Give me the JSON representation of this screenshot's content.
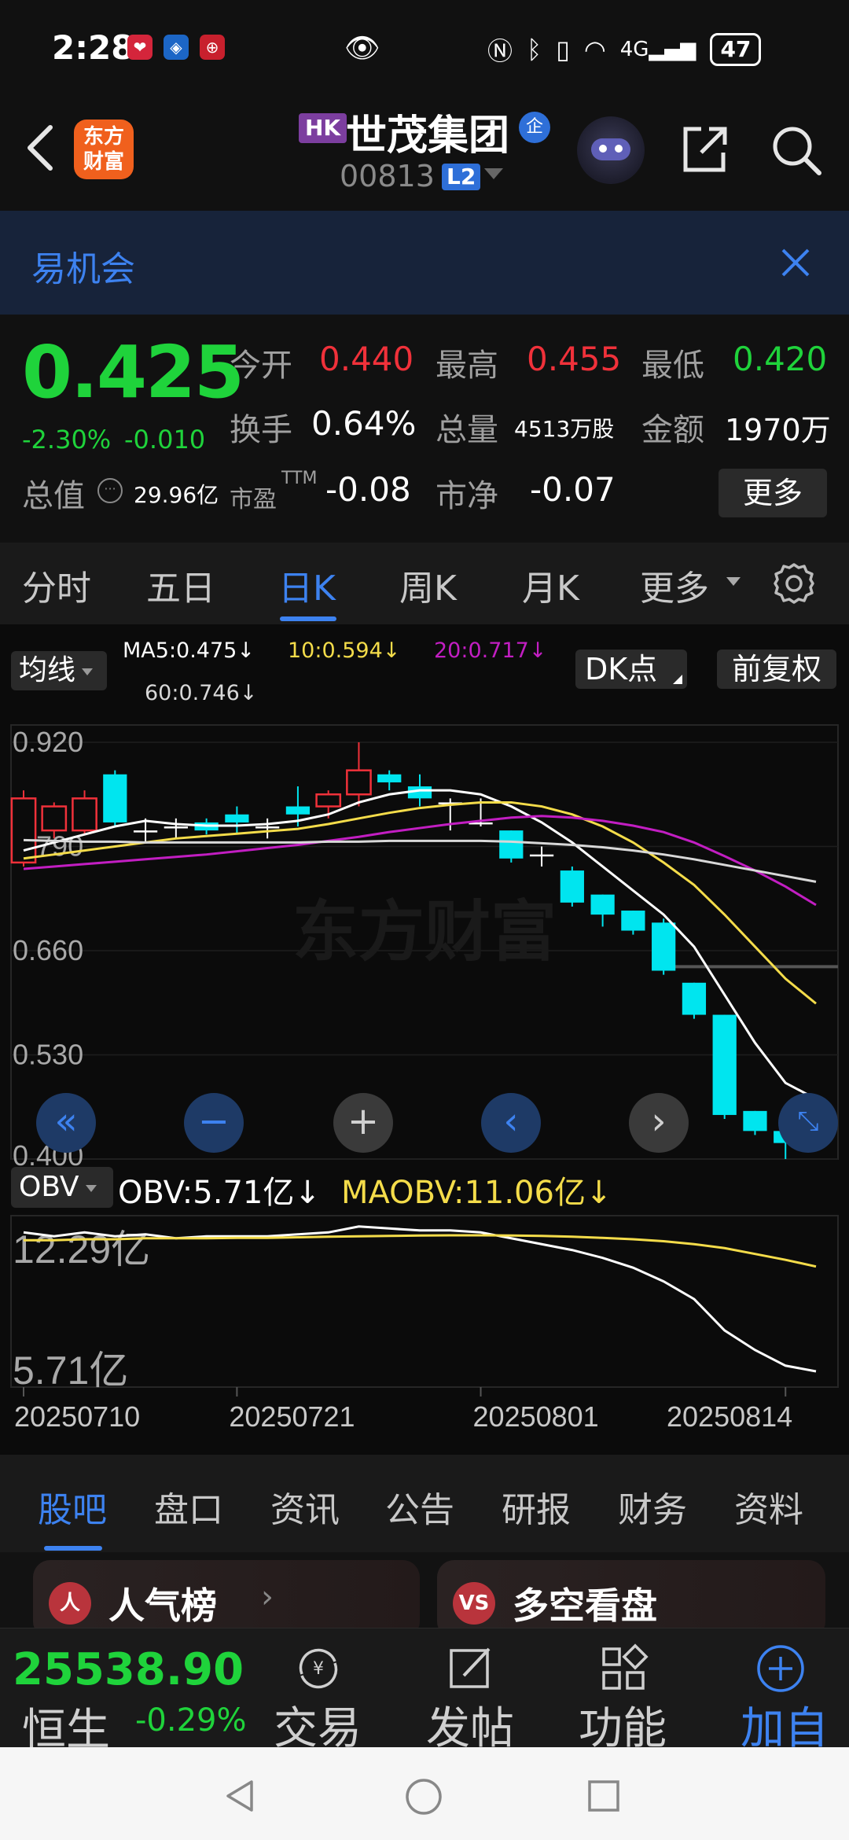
{
  "status_bar": {
    "time": "2:28",
    "battery": "47"
  },
  "header": {
    "logo_line1": "东方",
    "logo_line2": "财富",
    "market_badge": "HK",
    "stock_name": "世茂集团",
    "qi_badge": "企",
    "stock_code": "00813",
    "level_badge": "L2"
  },
  "banner": {
    "text": "易机会"
  },
  "quote": {
    "price": "0.425",
    "change_pct": "-2.30%",
    "change": "-0.010",
    "open_label": "今开",
    "open_value": "0.440",
    "high_label": "最高",
    "high_value": "0.455",
    "low_label": "最低",
    "low_value": "0.420",
    "turnover_label": "换手",
    "turnover_value": "0.64%",
    "volume_label": "总量",
    "volume_value": "4513万股",
    "amount_label": "金额",
    "amount_value": "1970万",
    "mktcap_label": "总值",
    "mktcap_value": "29.96亿",
    "pe_label": "市盈",
    "pe_sup": "TTM",
    "pe_value": "-0.08",
    "pb_label": "市净",
    "pb_value": "-0.07",
    "more_label": "更多"
  },
  "period_tabs": [
    "分时",
    "五日",
    "日K",
    "周K",
    "月K",
    "更多"
  ],
  "active_period": "日K",
  "indicators": {
    "ma_select": "均线",
    "ma5": "MA5:0.475↓",
    "ma10": "10:0.594↓",
    "ma20": "20:0.717↓",
    "ma60": "60:0.746↓",
    "dk_label": "DK点",
    "fq_label": "前复权",
    "obv_select": "OBV",
    "obv_value": "OBV:5.71亿↓",
    "maobv_value": "MAOBV:11.06亿↓"
  },
  "colors": {
    "up": "#f0313a",
    "down": "#1fd33b",
    "bar_down": "#00e5ef",
    "ma5": "#ffffff",
    "ma10": "#f4dc4a",
    "ma20": "#c21ec2",
    "ma60": "#d8d8d8",
    "accent": "#3d82f0"
  },
  "chart_data": {
    "type": "candlestick",
    "price_ticks": [
      "0.920",
      "0.790",
      "0.660",
      "0.530",
      "0.400"
    ],
    "ylim": [
      0.4,
      0.92
    ],
    "x_ticks": [
      "20250710",
      "20250721",
      "20250801",
      "20250814"
    ],
    "candles": [
      {
        "o": 0.77,
        "c": 0.85,
        "h": 0.86,
        "l": 0.765
      },
      {
        "o": 0.81,
        "c": 0.84,
        "h": 0.845,
        "l": 0.8
      },
      {
        "o": 0.81,
        "c": 0.85,
        "h": 0.86,
        "l": 0.805
      },
      {
        "o": 0.88,
        "c": 0.82,
        "h": 0.885,
        "l": 0.815
      },
      {
        "o": 0.81,
        "c": 0.81,
        "h": 0.825,
        "l": 0.795
      },
      {
        "o": 0.815,
        "c": 0.815,
        "h": 0.825,
        "l": 0.8
      },
      {
        "o": 0.82,
        "c": 0.81,
        "h": 0.825,
        "l": 0.805
      },
      {
        "o": 0.83,
        "c": 0.82,
        "h": 0.84,
        "l": 0.805
      },
      {
        "o": 0.815,
        "c": 0.815,
        "h": 0.825,
        "l": 0.8
      },
      {
        "o": 0.84,
        "c": 0.83,
        "h": 0.865,
        "l": 0.815
      },
      {
        "o": 0.84,
        "c": 0.855,
        "h": 0.86,
        "l": 0.825
      },
      {
        "o": 0.855,
        "c": 0.885,
        "h": 0.92,
        "l": 0.84
      },
      {
        "o": 0.88,
        "c": 0.87,
        "h": 0.885,
        "l": 0.86
      },
      {
        "o": 0.865,
        "c": 0.85,
        "h": 0.88,
        "l": 0.84
      },
      {
        "o": 0.845,
        "c": 0.845,
        "h": 0.85,
        "l": 0.81
      },
      {
        "o": 0.82,
        "c": 0.82,
        "h": 0.85,
        "l": 0.815
      },
      {
        "o": 0.81,
        "c": 0.775,
        "h": 0.81,
        "l": 0.77
      },
      {
        "o": 0.78,
        "c": 0.78,
        "h": 0.79,
        "l": 0.765
      },
      {
        "o": 0.76,
        "c": 0.72,
        "h": 0.765,
        "l": 0.715
      },
      {
        "o": 0.73,
        "c": 0.705,
        "h": 0.73,
        "l": 0.69
      },
      {
        "o": 0.71,
        "c": 0.685,
        "h": 0.71,
        "l": 0.68
      },
      {
        "o": 0.695,
        "c": 0.635,
        "h": 0.7,
        "l": 0.63
      },
      {
        "o": 0.62,
        "c": 0.58,
        "h": 0.62,
        "l": 0.575
      },
      {
        "o": 0.58,
        "c": 0.455,
        "h": 0.58,
        "l": 0.45
      },
      {
        "o": 0.46,
        "c": 0.435,
        "h": 0.46,
        "l": 0.43
      },
      {
        "o": 0.435,
        "c": 0.42,
        "h": 0.44,
        "l": 0.4
      },
      {
        "o": 0.44,
        "c": 0.425,
        "h": 0.455,
        "l": 0.42
      }
    ],
    "series": [
      {
        "name": "MA5",
        "values": [
          0.785,
          0.795,
          0.805,
          0.815,
          0.822,
          0.818,
          0.816,
          0.816,
          0.818,
          0.822,
          0.83,
          0.845,
          0.855,
          0.86,
          0.86,
          0.855,
          0.84,
          0.82,
          0.795,
          0.765,
          0.735,
          0.705,
          0.665,
          0.605,
          0.545,
          0.495,
          0.475
        ]
      },
      {
        "name": "10",
        "values": [
          0.775,
          0.78,
          0.785,
          0.79,
          0.795,
          0.8,
          0.803,
          0.806,
          0.809,
          0.812,
          0.818,
          0.825,
          0.832,
          0.838,
          0.842,
          0.845,
          0.845,
          0.84,
          0.83,
          0.815,
          0.795,
          0.77,
          0.742,
          0.705,
          0.665,
          0.625,
          0.594
        ]
      },
      {
        "name": "20",
        "values": [
          0.762,
          0.765,
          0.768,
          0.771,
          0.774,
          0.777,
          0.78,
          0.784,
          0.788,
          0.792,
          0.797,
          0.802,
          0.808,
          0.813,
          0.818,
          0.822,
          0.826,
          0.828,
          0.826,
          0.822,
          0.816,
          0.808,
          0.795,
          0.778,
          0.76,
          0.74,
          0.717
        ]
      },
      {
        "name": "60",
        "values": [
          0.798,
          0.797,
          0.796,
          0.796,
          0.795,
          0.795,
          0.795,
          0.795,
          0.795,
          0.795,
          0.796,
          0.796,
          0.797,
          0.797,
          0.797,
          0.797,
          0.796,
          0.794,
          0.792,
          0.789,
          0.785,
          0.78,
          0.774,
          0.767,
          0.76,
          0.753,
          0.746
        ]
      },
      {
        "name": "OBV",
        "values": [
          12.8,
          12.6,
          12.8,
          12.6,
          12.7,
          12.5,
          12.6,
          12.6,
          12.6,
          12.7,
          12.8,
          13.1,
          13.0,
          12.9,
          12.9,
          12.8,
          12.5,
          12.2,
          11.9,
          11.5,
          11.0,
          10.3,
          9.4,
          7.8,
          6.8,
          6.0,
          5.71
        ]
      },
      {
        "name": "MAOBV",
        "values": [
          12.4,
          12.4,
          12.45,
          12.45,
          12.5,
          12.5,
          12.5,
          12.52,
          12.52,
          12.55,
          12.58,
          12.6,
          12.62,
          12.64,
          12.65,
          12.65,
          12.64,
          12.62,
          12.58,
          12.52,
          12.45,
          12.35,
          12.2,
          12.0,
          11.7,
          11.4,
          11.06
        ]
      }
    ],
    "obv_ticks": [
      "12.29亿",
      "5.71亿"
    ],
    "obv_ylim": [
      5.71,
      12.29
    ],
    "ylabel": "",
    "xlabel": ""
  },
  "chart_controls": [
    "«",
    "−",
    "+",
    "‹",
    "›"
  ],
  "bottom_tabs": [
    "股吧",
    "盘口",
    "资讯",
    "公告",
    "研报",
    "财务",
    "资料"
  ],
  "active_bottom_tab": "股吧",
  "cards": [
    {
      "icon": "人",
      "title": "人气榜"
    },
    {
      "icon": "VS",
      "title": "多空看盘"
    }
  ],
  "bottom_nav": {
    "hs_value": "25538.90",
    "hs_name": "恒生",
    "hs_pct": "-0.29%",
    "trade": "交易",
    "post": "发帖",
    "function": "功能",
    "add_watch": "加自选"
  }
}
